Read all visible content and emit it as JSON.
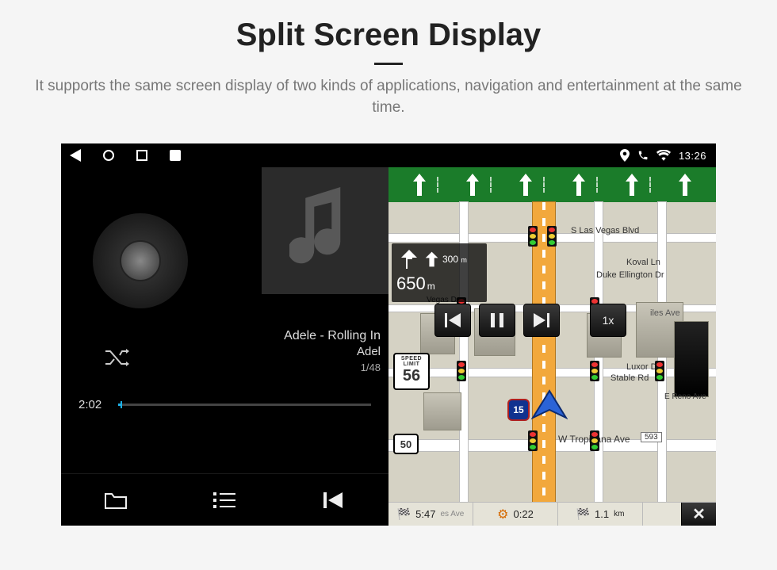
{
  "header": {
    "title": "Split Screen Display",
    "subtitle": "It supports the same screen display of two kinds of applications, navigation and entertainment at the same time."
  },
  "statusbar": {
    "time": "13:26"
  },
  "music": {
    "track_title": "Adele - Rolling In",
    "artist": "Adel",
    "index": "1/48",
    "elapsed": "2:02",
    "progress_pct": 1
  },
  "nav": {
    "turn": {
      "small_dist": "300",
      "small_unit": "m",
      "big_dist": "650",
      "big_unit": "m"
    },
    "speed_label": "SPEED LIMIT",
    "speed_value": "56",
    "route_sign": "50",
    "highway_sign": "15",
    "speed_multiplier": "1x",
    "streets": {
      "s_las_vegas": "S Las Vegas Blvd",
      "koval": "Koval Ln",
      "duke": "Duke Ellington Dr",
      "luxor": "Luxor Dr",
      "stable": "Stable Rd",
      "reno": "E Reno Ave",
      "tropicana": "W Tropicana Ave",
      "vegas_dr": "Vegas Dr",
      "tropicana_unit": "593"
    },
    "bottom": {
      "eta": "5:47",
      "eta_label_suffix": "es Ave",
      "duration": "0:22",
      "distance": "1.1",
      "distance_unit": "km"
    }
  },
  "overlay_prefix": "iles Ave"
}
